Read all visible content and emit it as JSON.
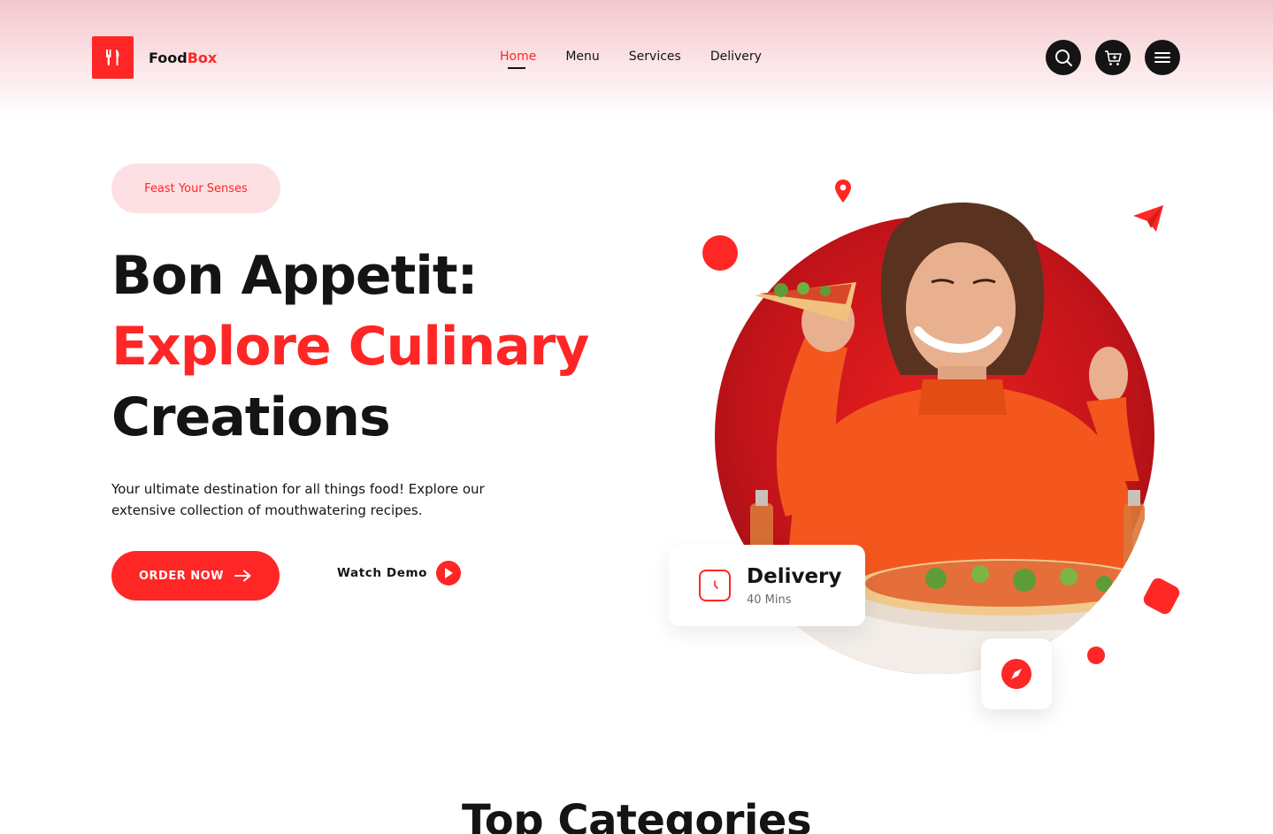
{
  "brand": {
    "name_part1": "Food",
    "name_part2": "Box",
    "accent_color": "#ff2626"
  },
  "nav": {
    "items": [
      {
        "label": "Home",
        "active": true
      },
      {
        "label": "Menu",
        "active": false
      },
      {
        "label": "Services",
        "active": false
      },
      {
        "label": "Delivery",
        "active": false
      }
    ]
  },
  "header_icons": [
    "search-icon",
    "cart-icon",
    "menu-icon"
  ],
  "hero": {
    "badge": "Feast Your Senses",
    "title_line1": "Bon Appetit:",
    "title_line2": "Explore Culinary",
    "title_line3": "Creations",
    "description": "Your ultimate destination for all things food! Explore our extensive collection of mouthwatering recipes.",
    "order_button": "ORDER NOW",
    "watch_demo": "Watch Demo"
  },
  "delivery_card": {
    "title": "Delivery",
    "time": "40 Mins"
  },
  "categories": {
    "title": "Top Categories"
  }
}
